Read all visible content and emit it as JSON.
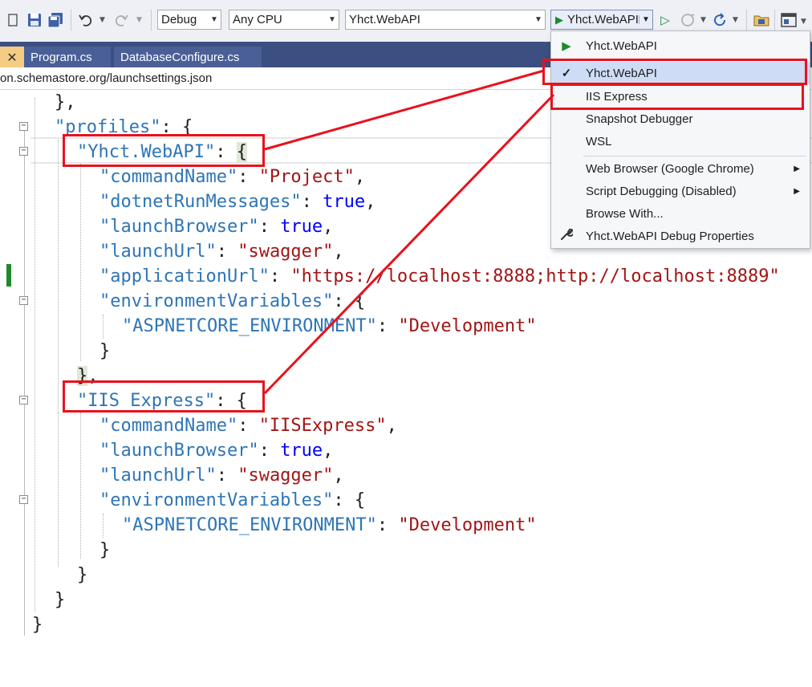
{
  "toolbar": {
    "configuration": "Debug",
    "platform": "Any CPU",
    "startup_project": "Yhct.WebAPI",
    "start_button_label": "Yhct.WebAPI"
  },
  "tabs": [
    {
      "label": "Program.cs"
    },
    {
      "label": "DatabaseConfigure.cs"
    }
  ],
  "schema_url": "on.schemastore.org/launchsettings.json",
  "code": {
    "l1": "},",
    "l2_key": "\"profiles\"",
    "l3_key": "\"Yhct.WebAPI\"",
    "l4_key": "\"commandName\"",
    "l4_val": "\"Project\"",
    "l5_key": "\"dotnetRunMessages\"",
    "l5_val": "true",
    "l6_key": "\"launchBrowser\"",
    "l6_val": "true",
    "l7_key": "\"launchUrl\"",
    "l7_val": "\"swagger\"",
    "l8_key": "\"applicationUrl\"",
    "l8_val": "\"https://localhost:8888;http://localhost:8889\"",
    "l9_key": "\"environmentVariables\"",
    "l10_key": "\"ASPNETCORE_ENVIRONMENT\"",
    "l10_val": "\"Development\"",
    "l13_key": "\"IIS Express\"",
    "l14_key": "\"commandName\"",
    "l14_val": "\"IISExpress\"",
    "l15_key": "\"launchBrowser\"",
    "l15_val": "true",
    "l16_key": "\"launchUrl\"",
    "l16_val": "\"swagger\"",
    "l17_key": "\"environmentVariables\"",
    "l18_key": "\"ASPNETCORE_ENVIRONMENT\"",
    "l18_val": "\"Development\""
  },
  "menu": {
    "items": [
      {
        "label": "Yhct.WebAPI",
        "icon": "play-icon"
      },
      {
        "label": "Yhct.WebAPI",
        "icon": "checkmark-icon",
        "selected": true
      },
      {
        "label": "IIS Express"
      },
      {
        "label": "Snapshot Debugger"
      },
      {
        "label": "WSL"
      },
      {
        "label": "Web Browser (Google Chrome)",
        "submenu": true
      },
      {
        "label": "Script Debugging (Disabled)",
        "submenu": true
      },
      {
        "label": "Browse With..."
      },
      {
        "label": "Yhct.WebAPI Debug Properties",
        "icon": "wrench-icon"
      }
    ]
  },
  "colors": {
    "annotation_red": "#e8121d",
    "json_key": "#2e75b6",
    "json_string": "#a31515",
    "json_bool": "#0000ff",
    "tab_bar": "#3b4f81"
  }
}
